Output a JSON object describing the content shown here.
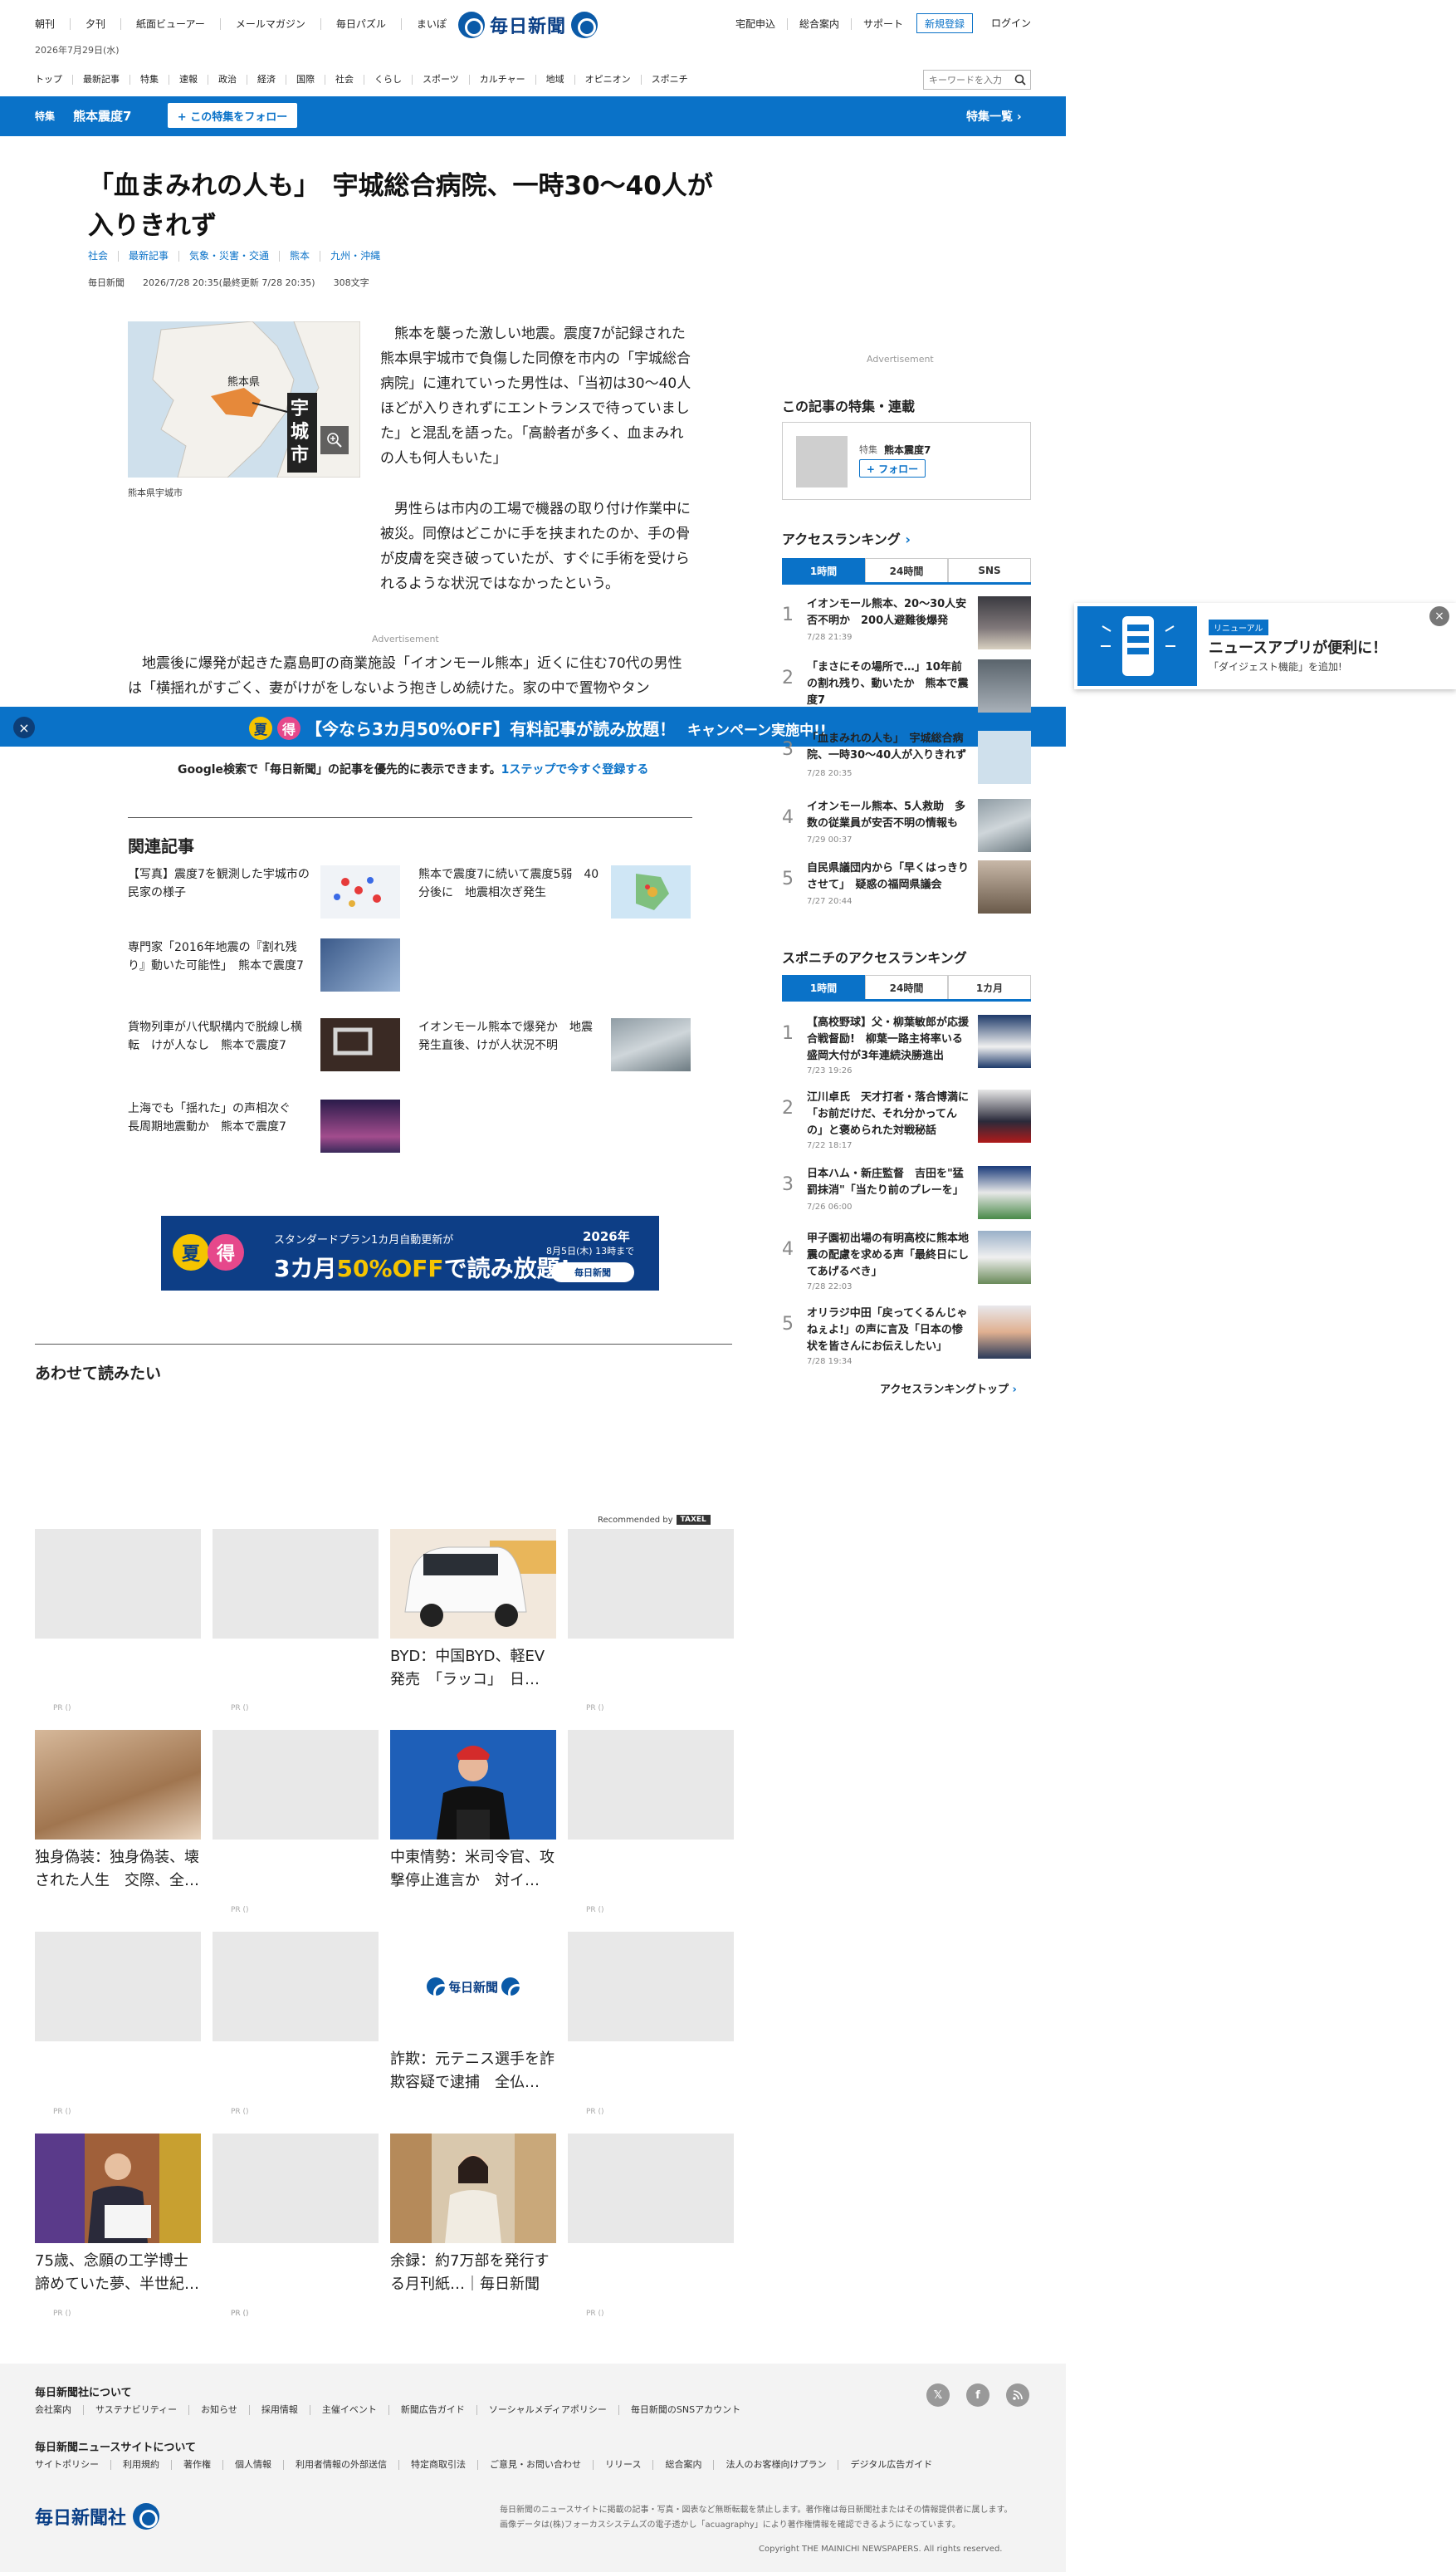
{
  "header": {
    "top_links": [
      "朝刊",
      "夕刊",
      "紙面ビューアー",
      "メールマガジン",
      "毎日パズル",
      "まいぽ"
    ],
    "date": "2026年7月29日(水)",
    "logo_text": "毎日新聞",
    "right_links": [
      "宅配申込",
      "総合案内",
      "サポート"
    ],
    "signup_label": "新規登録",
    "login_label": "ログイン",
    "search_placeholder": "キーワードを入力",
    "nav": [
      "トップ",
      "最新記事",
      "特集",
      "速報",
      "政治",
      "経済",
      "国際",
      "社会",
      "くらし",
      "スポーツ",
      "カルチャー",
      "地域",
      "オピニオン",
      "スポニチ"
    ]
  },
  "feature_bar": {
    "tag": "特集",
    "title": "熊本震度7",
    "follow_label": "+ この特集をフォロー",
    "list_label": "特集一覧"
  },
  "article": {
    "headline": "「血まみれの人も」　宇城総合病院、一時30〜40人が入りきれず",
    "tags": [
      "社会",
      "最新記事",
      "気象・災害・交通",
      "熊本",
      "九州・沖縄"
    ],
    "source": "毎日新聞",
    "datetime": "2026/7/28 20:35(最終更新 7/28 20:35)",
    "char_count": "308文字",
    "map_label_pref": "熊本県",
    "map_label_city": "宇城市",
    "map_caption": "熊本県宇城市",
    "para1": "熊本を襲った激しい地震。震度7が記録された熊本県宇城市で負傷した同僚を市内の「宇城総合病院」に連れていった男性は、「当初は30〜40人ほどが入りきれずにエントランスで待っていました」と混乱を語った。「高齢者が多く、血まみれの人も何人もいた」",
    "para2": "男性らは市内の工場で機器の取り付け作業中に被災。同僚はどこかに手を挟まれたのか、手の骨が皮膚を突き破っていたが、すぐに手術を受けられるような状況ではなかったという。",
    "ad_label": "Advertisement",
    "para3": "地震後に爆発が起きた嘉島町の商業施設「イオンモール熊本」近くに住む70代の男性は「横揺れがすごく、妻がけがをしないよう抱きしめ続けた。家の中で置物やタン"
  },
  "promo": {
    "natsu": "夏",
    "toku": "得",
    "text": "【今なら3カ月50%OFF】有料記事が読み放題！",
    "sub": "キャンペーン実施中!!",
    "close": "×"
  },
  "google_line": {
    "text": "Google検索で「毎日新聞」の記事を優先的に表示できます。",
    "link": "1ステップで今すぐ登録する"
  },
  "related": {
    "heading": "関連記事",
    "items": [
      "【写真】震度7を観測した宇城市の民家の様子",
      "熊本で震度7に続いて震度5弱　40分後に　地震相次ぎ発生",
      "専門家「2016年地震の『割れ残り』動いた可能性」　熊本で震度7",
      "貨物列車が八代駅構内で脱線し横転　けが人なし　熊本で震度7",
      "イオンモール熊本で爆発か　地震発生直後、けが人状況不明",
      "上海でも「揺れた」の声相次ぐ　長周期地震動か　熊本で震度7"
    ]
  },
  "banner": {
    "natsu": "夏",
    "toku": "得",
    "top": "スタンダードプラン1カ月自動更新が",
    "main_pre": "3カ月",
    "main_highlight": "50%OFF",
    "main_post": "で読み放題!",
    "year": "2026年",
    "date": "8月5日(木) 13時まで",
    "logo": "毎日新聞"
  },
  "also": {
    "heading": "あわせて読みたい",
    "recommended": "Recommended by",
    "taxel": "TAXEL",
    "pr": "PR ()",
    "captions": {
      "byd": "BYD：中国BYD、軽EV発売　「ラッコ」　日…",
      "dokushin": "独身偽装：独身偽装、壊された人生　交際、全…",
      "chuto": "中東情勢：米司令官、攻撃停止進言か　対イ…",
      "sagi": "詐欺：元テニス選手を詐欺容疑で逮捕　全仏…",
      "hakase": "75歳、念願の工学博士　諦めていた夢、半世紀…",
      "yoroku": "余録：約7万部を発行する月刊紙…｜毎日新聞"
    },
    "placeholder_logo": "毎日新聞"
  },
  "sidebar": {
    "ad_label": "Advertisement",
    "feature_heading": "この記事の特集・連載",
    "feature_tag": "特集",
    "feature_title": "熊本震度7",
    "feature_follow": "+ フォロー",
    "ranking_heading": "アクセスランキング",
    "ranking_tabs": [
      "1時間",
      "24時間",
      "SNS"
    ],
    "ranking": [
      {
        "rank": "1",
        "title": "イオンモール熊本、20〜30人安否不明か　200人避難後爆発",
        "time": "7/28 21:39"
      },
      {
        "rank": "2",
        "title": "「まさにその場所で…」10年前の割れ残り、動いたか　熊本で震度7",
        "time": ""
      },
      {
        "rank": "3",
        "title": "「血まみれの人も」　宇城総合病院、一時30〜40人が入りきれず",
        "time": "7/28 20:35"
      },
      {
        "rank": "4",
        "title": "イオンモール熊本、5人救助　多数の従業員が安否不明の情報も",
        "time": "7/29 00:37"
      },
      {
        "rank": "5",
        "title": "自民県議団内から「早くはっきりさせて」　疑惑の福岡県議会",
        "time": "7/27 20:44"
      }
    ],
    "sponichi_heading": "スポニチのアクセスランキング",
    "sponichi_tabs": [
      "1時間",
      "24時間",
      "1カ月"
    ],
    "sponichi": [
      {
        "rank": "1",
        "title": "【高校野球】父・柳葉敏郎が応援合戦督励!　柳葉一路主将率いる盛岡大付が3年連続決勝進出",
        "time": "7/23 19:26"
      },
      {
        "rank": "2",
        "title": "江川卓氏　天才打者・落合博満に「お前だけだ、それ分かってんの」と褒められた対戦秘話",
        "time": "7/22 18:17"
      },
      {
        "rank": "3",
        "title": "日本ハム・新庄監督　吉田を\"猛罰抹消\"「当たり前のプレーを」",
        "time": "7/26 06:00"
      },
      {
        "rank": "4",
        "title": "甲子園初出場の有明高校に熊本地震の配慮を求める声「最終日にしてあげるべき」",
        "time": "7/28 22:03"
      },
      {
        "rank": "5",
        "title": "オリラジ中田「戻ってくるんじゃねぇよ!」の声に言及「日本の惨状を皆さんにお伝えしたい」",
        "time": "7/28 19:34"
      }
    ],
    "ranking_top_label": "アクセスランキングトップ"
  },
  "app_popup": {
    "tag": "リニューアル",
    "title": "ニュースアプリが便利に！",
    "sub": "「ダイジェスト機能」を追加!",
    "close": "×"
  },
  "footer": {
    "about_heading": "毎日新聞社について",
    "about_links": [
      "会社案内",
      "サステナビリティー",
      "お知らせ",
      "採用情報",
      "主催イベント",
      "新聞広告ガイド",
      "ソーシャルメディアポリシー",
      "毎日新聞のSNSアカウント"
    ],
    "site_heading": "毎日新聞ニュースサイトについて",
    "site_links": [
      "サイトポリシー",
      "利用規約",
      "著作権",
      "個人情報",
      "利用者情報の外部送信",
      "特定商取引法",
      "ご意見・お問い合わせ",
      "リリース",
      "総合案内",
      "法人のお客様向けプラン",
      "デジタル広告ガイド"
    ],
    "logo_text": "毎日新聞社",
    "notice1": "毎日新聞のニュースサイトに掲載の記事・写真・図表など無断転載を禁止します。著作権は毎日新聞社またはその情報提供者に属します。",
    "notice2": "画像データは(株)フォーカスシステムズの電子透かし「acuagraphy」により著作権情報を確認できるようになっています。",
    "copyright": "Copyright THE MAINICHI NEWSPAPERS. All rights reserved."
  },
  "colors": {
    "accent": "#0a72c8",
    "brand": "#0a3f86",
    "natsu": "#f5c400",
    "toku": "#e6488b"
  }
}
